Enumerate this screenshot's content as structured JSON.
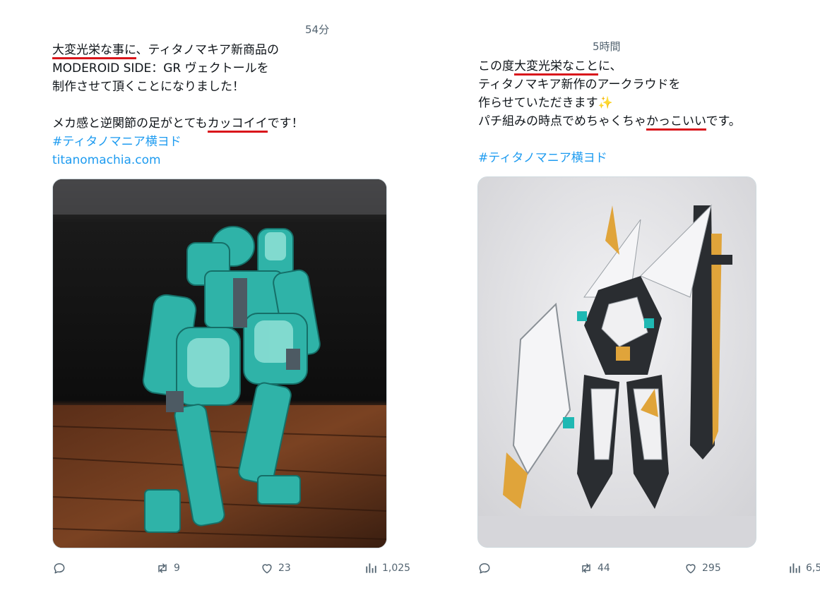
{
  "tweets": [
    {
      "time": "54分",
      "lines": [
        [
          {
            "t": "大変光栄な事に",
            "u": true
          },
          {
            "t": "、ティタノマキア新商品の",
            "u": false
          }
        ],
        [
          {
            "t": "MODEROID SIDE：GR ヴェクトールを",
            "u": false
          }
        ],
        [
          {
            "t": "制作させて頂くことになりました！",
            "u": false
          }
        ],
        [],
        [
          {
            "t": "メカ感と逆関節の足がとても",
            "u": false
          },
          {
            "t": "カッコイイ",
            "u": true
          },
          {
            "t": "です！",
            "u": false
          }
        ]
      ],
      "hashtag": "#ティタノマニア横ヨド",
      "link": "titanomachia.com",
      "image_alt": "Teal mecha model kit on a wooden surface",
      "stats": {
        "replies": "",
        "retweets": "9",
        "likes": "23",
        "views": "1,025"
      }
    },
    {
      "time": "5時間",
      "lines": [
        [
          {
            "t": "この度",
            "u": false
          },
          {
            "t": "大変光栄なこと",
            "u": true
          },
          {
            "t": "に、",
            "u": false
          }
        ],
        [
          {
            "t": "ティタノマキア新作のアークラウドを",
            "u": false
          }
        ],
        [
          {
            "t": "作らせていただきます",
            "u": false
          },
          {
            "t": "✨",
            "u": false,
            "s": true
          }
        ],
        [
          {
            "t": "パチ組みの時点でめちゃくちゃ",
            "u": false
          },
          {
            "t": "かっこいい",
            "u": true
          },
          {
            "t": "です。",
            "u": false
          }
        ],
        []
      ],
      "hashtag": "#ティタノマニア横ヨド",
      "link": "",
      "image_alt": "White, black and gold mecha model kit with a large sword",
      "stats": {
        "replies": "",
        "retweets": "44",
        "likes": "295",
        "views": "6,5"
      }
    }
  ],
  "icons": {
    "reply": "speech-bubble-icon",
    "retweet": "retweet-arrows-icon",
    "like": "heart-icon",
    "views": "bar-chart-icon"
  },
  "colors": {
    "link": "#1d9bf0",
    "underline": "#d9151b",
    "muted": "#536471",
    "text": "#0f1419"
  }
}
